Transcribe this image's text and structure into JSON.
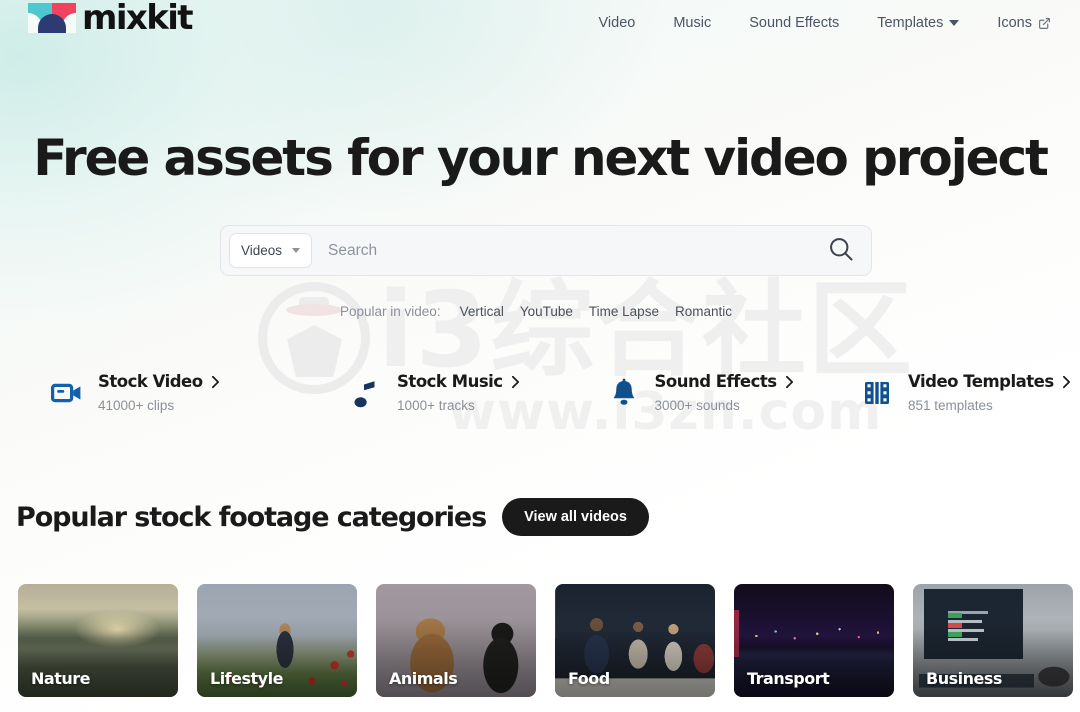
{
  "brand": {
    "name": "mixkit",
    "logo_icon": "mixkit-logo-icon",
    "colors": {
      "teal": "#4ec8cf",
      "pink": "#f1425f",
      "navy": "#2e3b72"
    }
  },
  "nav": {
    "items": [
      {
        "label": "Video",
        "icon": null
      },
      {
        "label": "Music",
        "icon": null
      },
      {
        "label": "Sound Effects",
        "icon": null
      },
      {
        "label": "Templates",
        "icon": "chevron-down-icon"
      },
      {
        "label": "Icons",
        "icon": "external-link-icon"
      }
    ]
  },
  "hero": {
    "title": "Free assets for your next video project"
  },
  "search": {
    "type_label": "Videos",
    "type_icon": "chevron-down-icon",
    "placeholder": "Search",
    "value": "",
    "submit_icon": "search-icon"
  },
  "popular": {
    "label": "Popular in video:",
    "tags": [
      "Vertical",
      "YouTube",
      "Time Lapse",
      "Romantic"
    ]
  },
  "shortcuts": [
    {
      "icon": "video-camera-icon",
      "title": "Stock Video",
      "chevron": "chevron-right-icon",
      "subtitle": "41000+ clips",
      "color": "#1161ad"
    },
    {
      "icon": "music-note-icon",
      "title": "Stock Music",
      "chevron": "chevron-right-icon",
      "subtitle": "1000+ tracks",
      "color": "#17345f"
    },
    {
      "icon": "bell-icon",
      "title": "Sound Effects",
      "chevron": "chevron-right-icon",
      "subtitle": "3000+ sounds",
      "color": "#11508f"
    },
    {
      "icon": "film-strip-icon",
      "title": "Video Templates",
      "chevron": "chevron-right-icon",
      "subtitle": "851 templates",
      "color": "#11508f"
    }
  ],
  "section": {
    "title": "Popular stock footage categories",
    "view_all_label": "View all videos"
  },
  "categories": [
    {
      "label": "Nature",
      "image": "wetland-sunset-photo"
    },
    {
      "label": "Lifestyle",
      "image": "girl-in-poppy-field-photo"
    },
    {
      "label": "Animals",
      "image": "two-dogs-studio-photo"
    },
    {
      "label": "Food",
      "image": "dinner-party-photo"
    },
    {
      "label": "Transport",
      "image": "night-city-skyline-photo"
    },
    {
      "label": "Business",
      "image": "laptop-typing-photo"
    }
  ],
  "watermark": {
    "badge_icon": "i3zh-logo-icon",
    "text_cn": "i3综合社区",
    "url": "www.i3zh.com"
  }
}
